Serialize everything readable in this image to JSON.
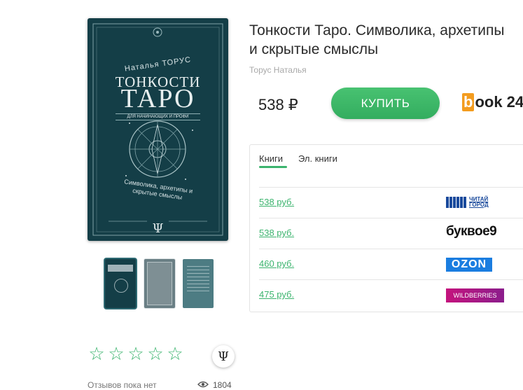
{
  "book": {
    "title": "Тонкости Таро. Символика, архетипы и скрытые смыслы",
    "author": "Торус Наталья"
  },
  "cover": {
    "author": "Наталья ТОРУС",
    "title_line1": "ТОНКОСТИ",
    "title_line2": "ТАРО",
    "subtitle": "ДЛЯ НАЧИНАЮЩИХ И ПРОФИ",
    "description": "Символика, архетипы и скрытые смыслы",
    "logo_glyph": "Ψ"
  },
  "purchase": {
    "price": "538",
    "currency": "₽",
    "buy_label": "КУПИТЬ",
    "seller": "book 24",
    "seller_b": "b",
    "seller_rest": "ook 24"
  },
  "tabs": [
    "Книги",
    "Эл. книги"
  ],
  "offers": [
    {
      "price": "538 руб.",
      "store": "ЧИТАЙ ГОРОД"
    },
    {
      "price": "538 руб.",
      "store": "буквоед"
    },
    {
      "price": "460 руб.",
      "store": "OZON"
    },
    {
      "price": "475 руб.",
      "store": "WILDBERRIES"
    }
  ],
  "store_logo_text": {
    "chitai_line1": "ЧИТАЙ",
    "chitai_line2": "ГОРОД",
    "bukvoed": "буквое9",
    "ozon": "OZON",
    "wildberries": "WILDBERRIES"
  },
  "rating": {
    "stars": [
      "☆",
      "☆",
      "☆",
      "☆",
      "☆"
    ],
    "reviews_text": "Отзывов пока нет",
    "views": "1804",
    "publisher_glyph": "Ψ"
  },
  "colors": {
    "accent": "#3cb46e",
    "cover": "#143e47"
  }
}
